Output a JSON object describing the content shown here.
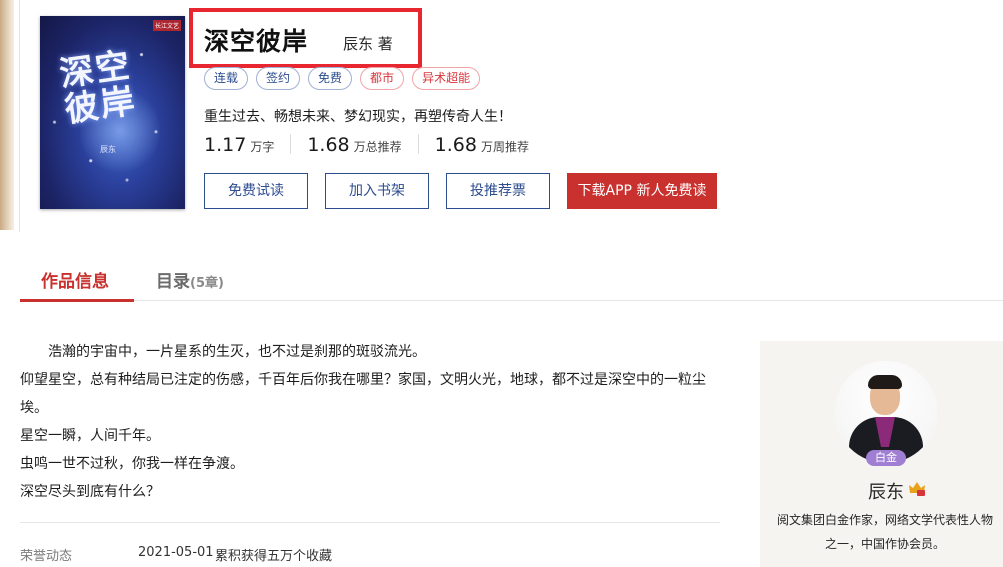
{
  "cover": {
    "publisher": "长江文艺",
    "title_art": "深空彼岸",
    "author_art": "辰东"
  },
  "book": {
    "title": "深空彼岸",
    "author": "辰东 著",
    "tags": [
      {
        "label": "连载",
        "style": "blue"
      },
      {
        "label": "签约",
        "style": "blue"
      },
      {
        "label": "免费",
        "style": "blue"
      },
      {
        "label": "都市",
        "style": "red"
      },
      {
        "label": "异术超能",
        "style": "red"
      }
    ],
    "intro": "重生过去、畅想未来、梦幻现实，再塑传奇人生！",
    "stats": [
      {
        "value": "1.17",
        "unit": "万字"
      },
      {
        "value": "1.68",
        "unit": "万总推荐"
      },
      {
        "value": "1.68",
        "unit": "万周推荐"
      }
    ]
  },
  "actions": {
    "free_read": "免费试读",
    "add_shelf": "加入书架",
    "vote": "投推荐票",
    "download": "下载APP 新人免费读"
  },
  "tabs": {
    "info": "作品信息",
    "catalog": "目录",
    "catalog_count": "(5章)"
  },
  "description": {
    "lines": [
      "浩瀚的宇宙中，一片星系的生灭，也不过是刹那的斑驳流光。",
      "仰望星空，总有种结局已注定的伤感，千百年后你我在哪里？家国，文明火光，地球，都不过是深空中的一粒尘埃。",
      "星空一瞬，人间千年。",
      "虫鸣一世不过秋，你我一样在争渡。",
      "深空尽头到底有什么？"
    ]
  },
  "honors": {
    "label": "荣誉动态",
    "date": "2021-05-01",
    "text": "累积获得五万个收藏"
  },
  "author_card": {
    "level": "白金",
    "name": "辰东",
    "bio": "阅文集团白金作家，网络文学代表性人物之一，中国作协会员。"
  },
  "colors": {
    "accent_red": "#c8312e",
    "tag_blue": "#2d4d8f",
    "highlight_box": "#e8262f"
  }
}
